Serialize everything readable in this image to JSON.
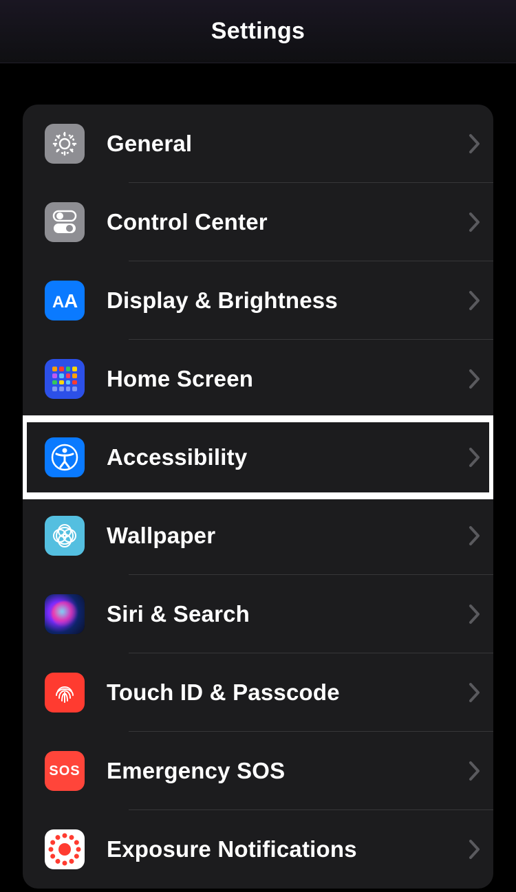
{
  "header": {
    "title": "Settings"
  },
  "group1": {
    "items": [
      {
        "id": "general",
        "label": "General",
        "icon": "gear-icon",
        "bg": "bg-gray",
        "highlighted": false
      },
      {
        "id": "control-center",
        "label": "Control Center",
        "icon": "control-center-icon",
        "bg": "bg-gray",
        "highlighted": false
      },
      {
        "id": "display-brightness",
        "label": "Display & Brightness",
        "icon": "display-icon",
        "bg": "bg-blue",
        "highlighted": false
      },
      {
        "id": "home-screen",
        "label": "Home Screen",
        "icon": "home-screen-icon",
        "bg": "bg-deepblue",
        "highlighted": false
      },
      {
        "id": "accessibility",
        "label": "Accessibility",
        "icon": "accessibility-icon",
        "bg": "bg-blue",
        "highlighted": true
      },
      {
        "id": "wallpaper",
        "label": "Wallpaper",
        "icon": "wallpaper-icon",
        "bg": "bg-teal",
        "highlighted": false
      },
      {
        "id": "siri-search",
        "label": "Siri & Search",
        "icon": "siri-icon",
        "bg": "bg-black",
        "highlighted": false
      },
      {
        "id": "touch-id",
        "label": "Touch ID & Passcode",
        "icon": "fingerprint-icon",
        "bg": "bg-red",
        "highlighted": false
      },
      {
        "id": "emergency-sos",
        "label": "Emergency SOS",
        "icon": "sos-icon",
        "bg": "bg-redorange",
        "highlighted": false,
        "sos_text": "SOS"
      },
      {
        "id": "exposure-notifications",
        "label": "Exposure Notifications",
        "icon": "exposure-icon",
        "bg": "bg-white",
        "highlighted": false
      }
    ]
  }
}
